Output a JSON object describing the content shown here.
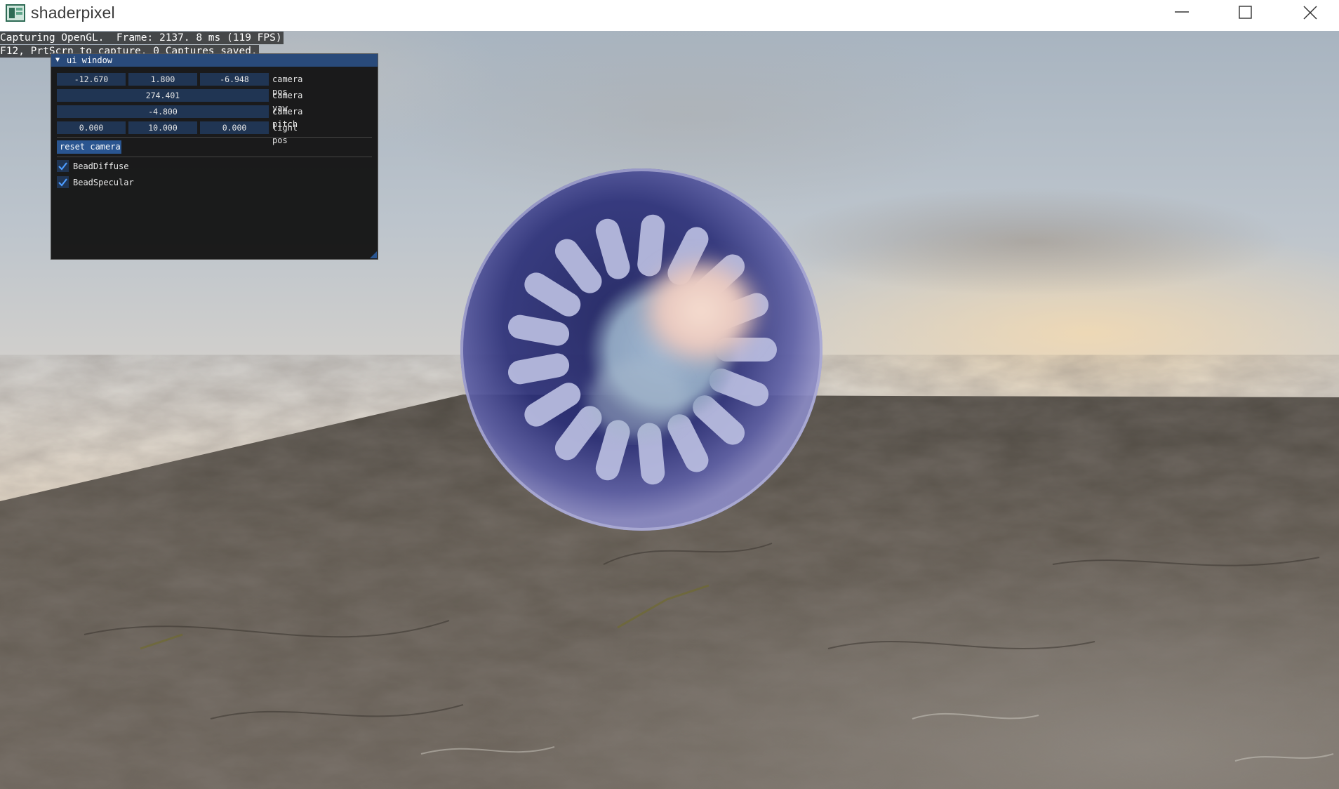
{
  "window": {
    "title": "shaderpixel",
    "icon": "app-window-icon",
    "controls": [
      "minimize-icon",
      "maximize-icon",
      "close-icon"
    ]
  },
  "overlay": {
    "line1": "Capturing OpenGL.  Frame: 2137. 8 ms (119 FPS)",
    "line2": "F12, PrtScrn to capture. 0 Captures saved."
  },
  "panel": {
    "title": "ui window",
    "camera_pos": {
      "x": "-12.670",
      "y": "1.800",
      "z": "-6.948",
      "label": "camera pos"
    },
    "camera_yaw": {
      "value": "274.401",
      "label": "camera yaw"
    },
    "camera_pitch": {
      "value": "-4.800",
      "label": "camera pitch"
    },
    "light_pos": {
      "x": "0.000",
      "y": "10.000",
      "z": "0.000",
      "label": "light pos"
    },
    "reset_label": "reset camera",
    "checkboxes": [
      {
        "label": "BeadDiffuse",
        "checked": true
      },
      {
        "label": "BeadSpecular",
        "checked": true
      }
    ]
  },
  "colors": {
    "panel_header": "#294a7a",
    "field_bg": "#203553",
    "button_bg": "#2a5590",
    "sphere_tint": "#3a3f8c"
  }
}
